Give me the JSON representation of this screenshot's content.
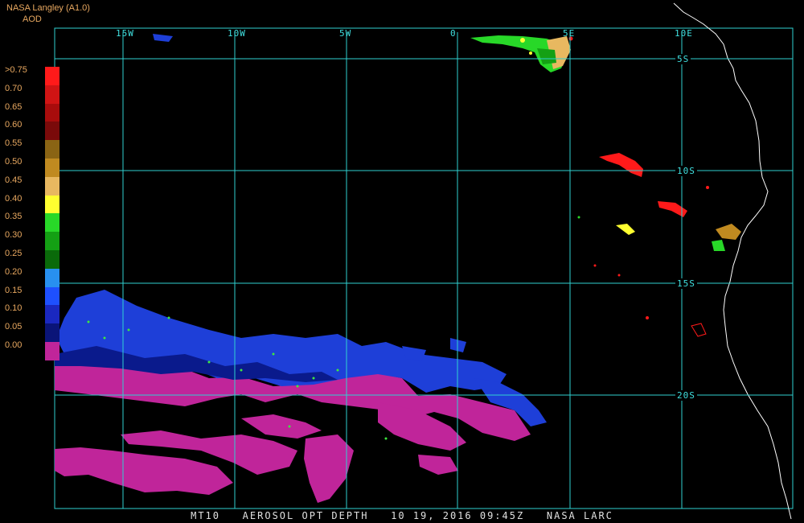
{
  "header": {
    "line1": "NASA Langley (A1.0)",
    "line2": "AOD"
  },
  "colorbar": [
    {
      "label": ">0.75",
      "color": "#ff1a1a"
    },
    {
      "label": "0.70",
      "color": "#d01414"
    },
    {
      "label": "0.65",
      "color": "#a80c0c"
    },
    {
      "label": "0.60",
      "color": "#7a0a0a"
    },
    {
      "label": "0.55",
      "color": "#8a6414"
    },
    {
      "label": "0.50",
      "color": "#c08a20"
    },
    {
      "label": "0.45",
      "color": "#e8b860"
    },
    {
      "label": "0.40",
      "color": "#ffff30"
    },
    {
      "label": "0.35",
      "color": "#28d828"
    },
    {
      "label": "0.30",
      "color": "#14a014"
    },
    {
      "label": "0.25",
      "color": "#0a6a0a"
    },
    {
      "label": "0.20",
      "color": "#2890f0"
    },
    {
      "label": "0.15",
      "color": "#1e50ff"
    },
    {
      "label": "0.10",
      "color": "#1a28c0"
    },
    {
      "label": "0.05",
      "color": "#0a1478"
    },
    {
      "label": "0.00",
      "color": "#c0259a"
    }
  ],
  "lon_ticks": [
    "15W",
    "10W",
    "5W",
    "0",
    "5E",
    "10E"
  ],
  "lat_ticks": [
    "5S",
    "10S",
    "15S",
    "20S"
  ],
  "footer": "MT10   AEROSOL OPT DEPTH   10 19, 2016 09:45Z   NASA LARC",
  "colors": {
    "grid": "#30d0d0",
    "coast": "#ffffff",
    "label": "#e8a860"
  }
}
